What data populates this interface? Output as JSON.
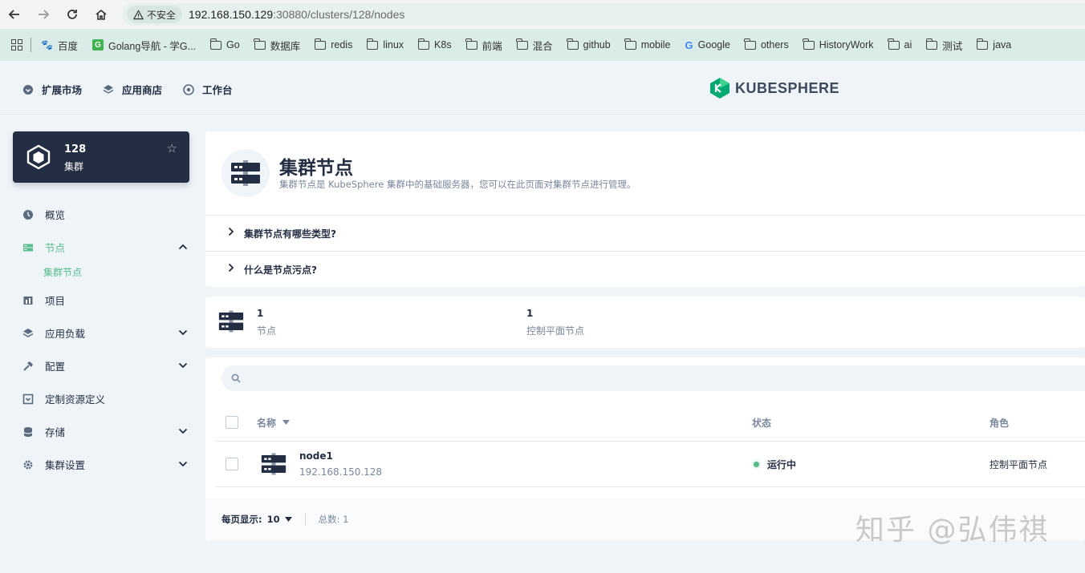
{
  "browser": {
    "insecure_label": "不安全",
    "url_host": "192.168.150.129",
    "url_rest": ":30880/clusters/128/nodes",
    "bookmarks": [
      {
        "label": "百度",
        "icon": "baidu-icon"
      },
      {
        "label": "Golang导航 - 学G...",
        "icon": "golang-nav-icon"
      },
      {
        "label": "Go",
        "icon": "folder-icon"
      },
      {
        "label": "数据库",
        "icon": "folder-icon"
      },
      {
        "label": "redis",
        "icon": "folder-icon"
      },
      {
        "label": "linux",
        "icon": "folder-icon"
      },
      {
        "label": "K8s",
        "icon": "folder-icon"
      },
      {
        "label": "前端",
        "icon": "folder-icon"
      },
      {
        "label": "混合",
        "icon": "folder-icon"
      },
      {
        "label": "github",
        "icon": "folder-icon"
      },
      {
        "label": "mobile",
        "icon": "folder-icon"
      },
      {
        "label": "Google",
        "icon": "google-icon"
      },
      {
        "label": "others",
        "icon": "folder-icon"
      },
      {
        "label": "HistoryWork",
        "icon": "folder-icon"
      },
      {
        "label": "ai",
        "icon": "folder-icon"
      },
      {
        "label": "测试",
        "icon": "folder-icon"
      },
      {
        "label": "java",
        "icon": "folder-icon"
      }
    ]
  },
  "header": {
    "nav": [
      {
        "label": "扩展市场"
      },
      {
        "label": "应用商店"
      },
      {
        "label": "工作台"
      }
    ],
    "logo_text": "KUBESPHERE"
  },
  "cluster": {
    "name": "128",
    "type": "集群"
  },
  "sidebar": {
    "items": [
      {
        "label": "概览"
      },
      {
        "label": "节点"
      },
      {
        "label": "项目"
      },
      {
        "label": "应用负载"
      },
      {
        "label": "配置"
      },
      {
        "label": "定制资源定义"
      },
      {
        "label": "存储"
      },
      {
        "label": "集群设置"
      }
    ],
    "sub_active": "集群节点"
  },
  "banner": {
    "title": "集群节点",
    "description": "集群节点是 KubeSphere 集群中的基础服务器，您可以在此页面对集群节点进行管理。",
    "faq": [
      "集群节点有哪些类型?",
      "什么是节点污点?"
    ]
  },
  "stats": [
    {
      "value": "1",
      "label": "节点"
    },
    {
      "value": "1",
      "label": "控制平面节点"
    }
  ],
  "table": {
    "search_placeholder": "",
    "columns": {
      "name": "名称",
      "status": "状态",
      "role": "角色"
    },
    "rows": [
      {
        "name": "node1",
        "ip": "192.168.150.128",
        "status": "运行中",
        "role": "控制平面节点"
      }
    ],
    "footer": {
      "per_page_label": "每页显示:",
      "per_page_value": "10",
      "total_label": "总数: 1"
    }
  },
  "watermark": "知乎 @弘伟祺",
  "colors": {
    "accent": "#55bc8a",
    "dark": "#242e42",
    "muted": "#79879c",
    "bg": "#eff4f9"
  }
}
